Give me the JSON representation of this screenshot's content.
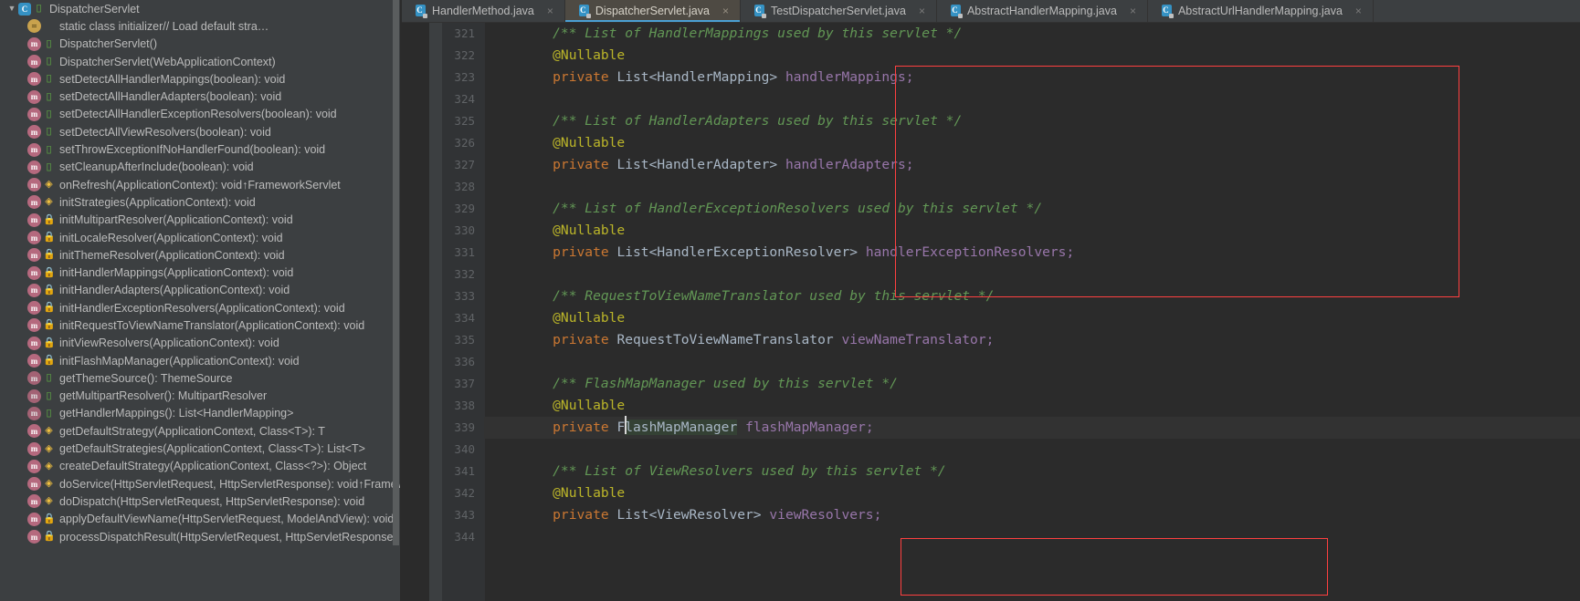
{
  "window": {
    "theme_bg": "#2b2b2b",
    "panel_bg": "#3c3f41",
    "accent": "#4a9fd4",
    "highlight_box_color": "#ff4040"
  },
  "structure_panel": {
    "root": {
      "label": "DispatcherServlet",
      "icon": "class-icon",
      "twisty": "▼"
    },
    "items": [
      {
        "badge": "init",
        "vis": "none",
        "label": "static class initializer ",
        "comment": "// Load default stra…"
      },
      {
        "badge": "method",
        "vis": "pub",
        "label": "DispatcherServlet()",
        "comment": ""
      },
      {
        "badge": "method",
        "vis": "pub",
        "label": "DispatcherServlet(WebApplicationContext)",
        "comment": ""
      },
      {
        "badge": "method",
        "vis": "pub",
        "label": "setDetectAllHandlerMappings(boolean): void",
        "comment": ""
      },
      {
        "badge": "method",
        "vis": "pub",
        "label": "setDetectAllHandlerAdapters(boolean): void",
        "comment": ""
      },
      {
        "badge": "method",
        "vis": "pub",
        "label": "setDetectAllHandlerExceptionResolvers(boolean): void",
        "comment": ""
      },
      {
        "badge": "method",
        "vis": "pub",
        "label": "setDetectAllViewResolvers(boolean): void",
        "comment": ""
      },
      {
        "badge": "method",
        "vis": "pub",
        "label": "setThrowExceptionIfNoHandlerFound(boolean): void",
        "comment": ""
      },
      {
        "badge": "method",
        "vis": "pub",
        "label": "setCleanupAfterInclude(boolean): void",
        "comment": ""
      },
      {
        "badge": "method",
        "vis": "prot",
        "label": "onRefresh(ApplicationContext): void ",
        "owner": "↑FrameworkServlet"
      },
      {
        "badge": "method",
        "vis": "prot",
        "label": "initStrategies(ApplicationContext): void",
        "comment": ""
      },
      {
        "badge": "method",
        "vis": "priv",
        "label": "initMultipartResolver(ApplicationContext): void",
        "comment": ""
      },
      {
        "badge": "method",
        "vis": "priv",
        "label": "initLocaleResolver(ApplicationContext): void",
        "comment": ""
      },
      {
        "badge": "method",
        "vis": "priv",
        "label": "initThemeResolver(ApplicationContext): void",
        "comment": ""
      },
      {
        "badge": "method",
        "vis": "priv",
        "label": "initHandlerMappings(ApplicationContext): void",
        "comment": ""
      },
      {
        "badge": "method",
        "vis": "priv",
        "label": "initHandlerAdapters(ApplicationContext): void",
        "comment": ""
      },
      {
        "badge": "method",
        "vis": "priv",
        "label": "initHandlerExceptionResolvers(ApplicationContext): void",
        "comment": ""
      },
      {
        "badge": "method",
        "vis": "priv",
        "label": "initRequestToViewNameTranslator(ApplicationContext): void",
        "comment": ""
      },
      {
        "badge": "method",
        "vis": "priv",
        "label": "initViewResolvers(ApplicationContext): void",
        "comment": ""
      },
      {
        "badge": "method",
        "vis": "priv",
        "label": "initFlashMapManager(ApplicationContext): void",
        "comment": ""
      },
      {
        "badge": "inherited",
        "vis": "pub",
        "label": "getThemeSource(): ThemeSource",
        "comment": ""
      },
      {
        "badge": "inherited",
        "vis": "pub",
        "label": "getMultipartResolver(): MultipartResolver",
        "comment": ""
      },
      {
        "badge": "inherited",
        "vis": "pub",
        "label": "getHandlerMappings(): List<HandlerMapping>",
        "comment": ""
      },
      {
        "badge": "method",
        "vis": "prot",
        "label": "getDefaultStrategy(ApplicationContext, Class<T>): T",
        "comment": ""
      },
      {
        "badge": "method",
        "vis": "prot",
        "label": "getDefaultStrategies(ApplicationContext, Class<T>): List<T>",
        "comment": ""
      },
      {
        "badge": "method",
        "vis": "prot",
        "label": "createDefaultStrategy(ApplicationContext, Class<?>): Object",
        "comment": ""
      },
      {
        "badge": "method",
        "vis": "prot",
        "label": "doService(HttpServletRequest, HttpServletResponse): void ",
        "owner": "↑Framewor"
      },
      {
        "badge": "method",
        "vis": "prot",
        "label": "doDispatch(HttpServletRequest, HttpServletResponse): void",
        "comment": ""
      },
      {
        "badge": "method",
        "vis": "priv",
        "label": "applyDefaultViewName(HttpServletRequest, ModelAndView): void",
        "comment": ""
      },
      {
        "badge": "method",
        "vis": "priv",
        "label": "processDispatchResult(HttpServletRequest, HttpServletResponse, Han",
        "comment": ""
      }
    ]
  },
  "tabs": [
    {
      "label": "HandlerMethod.java",
      "icon": "java-class-icon",
      "active": false,
      "close": "×"
    },
    {
      "label": "DispatcherServlet.java",
      "icon": "java-class-icon",
      "active": true,
      "close": "×"
    },
    {
      "label": "TestDispatcherServlet.java",
      "icon": "java-class-icon",
      "active": false,
      "close": "×"
    },
    {
      "label": "AbstractHandlerMapping.java",
      "icon": "java-class-icon",
      "active": false,
      "close": "×"
    },
    {
      "label": "AbstractUrlHandlerMapping.java",
      "icon": "java-class-icon",
      "active": false,
      "close": "×"
    }
  ],
  "editor": {
    "file": "DispatcherServlet.java",
    "caret_line": 339,
    "selected_text": "FlashMapManager",
    "first_line": 321,
    "lines": [
      {
        "n": "321",
        "tokens": [
          {
            "t": "comment",
            "s": "    /** List of HandlerMappings used by this servlet */"
          }
        ]
      },
      {
        "n": "322",
        "tokens": [
          {
            "t": "anno",
            "s": "    @Nullable"
          }
        ]
      },
      {
        "n": "323",
        "tokens": [
          {
            "t": "kw",
            "s": "    private "
          },
          {
            "t": "type",
            "s": "List<HandlerMapping> "
          },
          {
            "t": "field",
            "s": "handlerMappings;"
          }
        ]
      },
      {
        "n": "324",
        "tokens": [
          {
            "t": "plain",
            "s": ""
          }
        ]
      },
      {
        "n": "325",
        "tokens": [
          {
            "t": "comment",
            "s": "    /** List of HandlerAdapters used by this servlet */"
          }
        ]
      },
      {
        "n": "326",
        "tokens": [
          {
            "t": "anno",
            "s": "    @Nullable"
          }
        ]
      },
      {
        "n": "327",
        "tokens": [
          {
            "t": "kw",
            "s": "    private "
          },
          {
            "t": "type",
            "s": "List<HandlerAdapter> "
          },
          {
            "t": "field",
            "s": "handlerAdapters;"
          }
        ]
      },
      {
        "n": "328",
        "tokens": [
          {
            "t": "plain",
            "s": ""
          }
        ]
      },
      {
        "n": "329",
        "tokens": [
          {
            "t": "comment",
            "s": "    /** List of HandlerExceptionResolvers used by this servlet */"
          }
        ]
      },
      {
        "n": "330",
        "tokens": [
          {
            "t": "anno",
            "s": "    @Nullable"
          }
        ]
      },
      {
        "n": "331",
        "tokens": [
          {
            "t": "kw",
            "s": "    private "
          },
          {
            "t": "type",
            "s": "List<HandlerExceptionResolver> "
          },
          {
            "t": "field",
            "s": "handlerExceptionResolvers;"
          }
        ]
      },
      {
        "n": "332",
        "tokens": [
          {
            "t": "plain",
            "s": ""
          }
        ]
      },
      {
        "n": "333",
        "tokens": [
          {
            "t": "comment",
            "s": "    /** RequestToViewNameTranslator used by this servlet */"
          }
        ]
      },
      {
        "n": "334",
        "tokens": [
          {
            "t": "anno",
            "s": "    @Nullable"
          }
        ]
      },
      {
        "n": "335",
        "tokens": [
          {
            "t": "kw",
            "s": "    private "
          },
          {
            "t": "type",
            "s": "RequestToViewNameTranslator "
          },
          {
            "t": "field",
            "s": "viewNameTranslator;"
          }
        ]
      },
      {
        "n": "336",
        "tokens": [
          {
            "t": "plain",
            "s": ""
          }
        ]
      },
      {
        "n": "337",
        "tokens": [
          {
            "t": "comment",
            "s": "    /** FlashMapManager used by this servlet */"
          }
        ]
      },
      {
        "n": "338",
        "tokens": [
          {
            "t": "anno",
            "s": "    @Nullable"
          }
        ]
      },
      {
        "n": "339",
        "caret": true,
        "tokens": [
          {
            "t": "kw",
            "s": "    private "
          },
          {
            "t": "type",
            "s": "F"
          },
          {
            "t": "caret",
            "s": ""
          },
          {
            "t": "sel",
            "s": "lashMapManager"
          },
          {
            "t": "type",
            "s": " "
          },
          {
            "t": "field",
            "s": "flashMapManager;"
          }
        ]
      },
      {
        "n": "340",
        "tokens": [
          {
            "t": "plain",
            "s": ""
          }
        ]
      },
      {
        "n": "341",
        "tokens": [
          {
            "t": "comment",
            "s": "    /** List of ViewResolvers used by this servlet */"
          }
        ]
      },
      {
        "n": "342",
        "tokens": [
          {
            "t": "anno",
            "s": "    @Nullable"
          }
        ]
      },
      {
        "n": "343",
        "tokens": [
          {
            "t": "kw",
            "s": "    private "
          },
          {
            "t": "type",
            "s": "List<ViewResolver> "
          },
          {
            "t": "field",
            "s": "viewResolvers;"
          }
        ]
      },
      {
        "n": "344",
        "tokens": [
          {
            "t": "plain",
            "s": ""
          }
        ]
      }
    ],
    "annotations": [
      {
        "name": "handler-strategies-highlight",
        "lines": "322-332"
      },
      {
        "name": "view-resolvers-highlight",
        "lines": "342-344"
      }
    ]
  }
}
